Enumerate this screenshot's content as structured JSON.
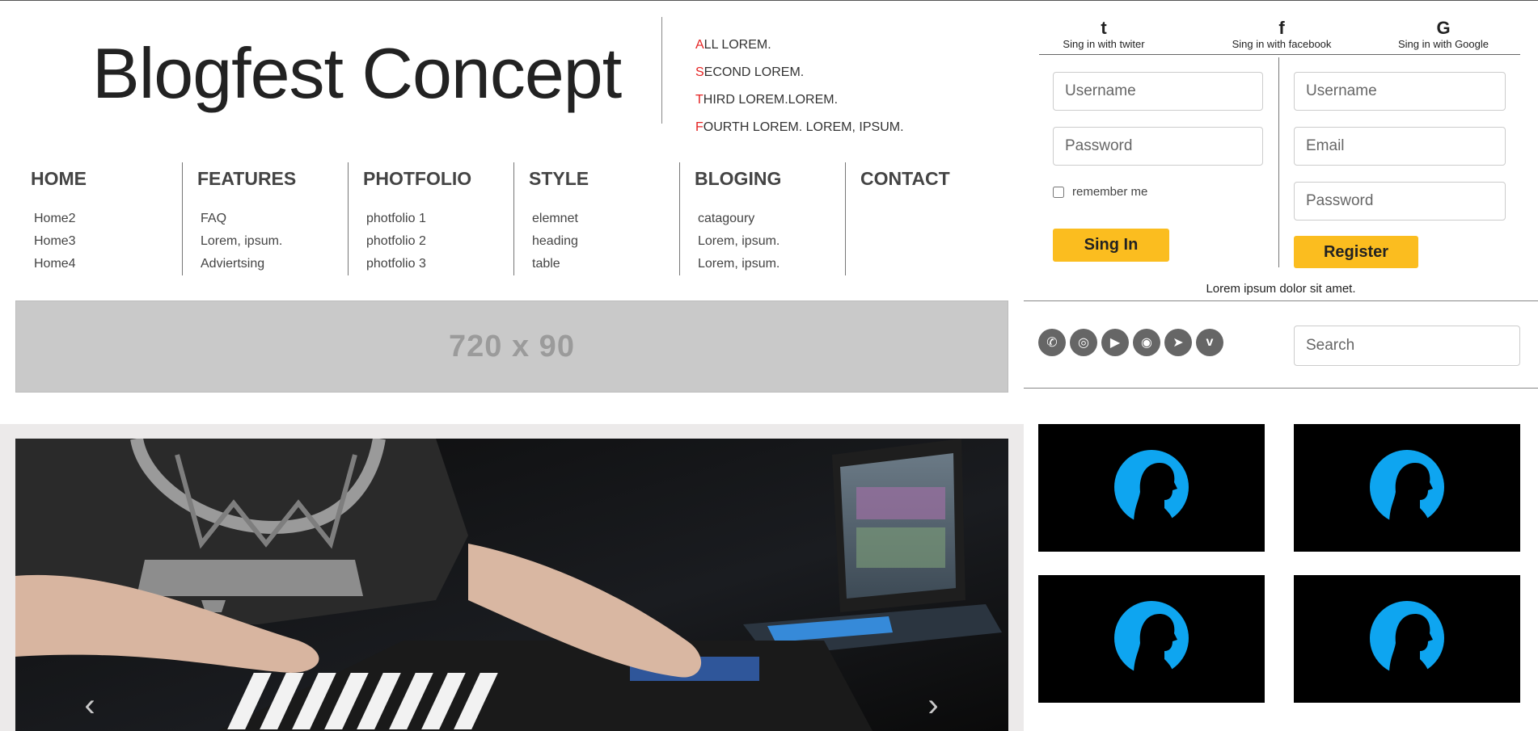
{
  "header": {
    "title": "Blogfest Concept",
    "quick_links": [
      {
        "first": "A",
        "rest": "LL LOREM."
      },
      {
        "first": "S",
        "rest": "ECOND LOREM."
      },
      {
        "first": "T",
        "rest": "HIRD LOREM.LOREM."
      },
      {
        "first": "F",
        "rest": "OURTH LOREM. LOREM, IPSUM."
      }
    ]
  },
  "nav": [
    {
      "title": "HOME",
      "items": [
        "Home2",
        "Home3",
        "Home4"
      ]
    },
    {
      "title": "FEATURES",
      "items": [
        "FAQ",
        "Lorem, ipsum.",
        "Adviertsing"
      ]
    },
    {
      "title": "PHOTFOLIO",
      "items": [
        "photfolio 1",
        "photfolio 2",
        "photfolio 3"
      ]
    },
    {
      "title": "STYLE",
      "items": [
        "elemnet",
        "heading",
        "table"
      ]
    },
    {
      "title": "BLOGING",
      "items": [
        "catagoury",
        "Lorem, ipsum.",
        "Lorem, ipsum."
      ]
    },
    {
      "title": "CONTACT",
      "items": []
    }
  ],
  "ad": {
    "label": "720 x 90"
  },
  "carousel": {
    "prev_icon": "chevron-left-icon",
    "next_icon": "chevron-right-icon",
    "prev": "‹",
    "next": "›"
  },
  "social_signin": [
    {
      "icon": "twitter-icon",
      "glyph": "t",
      "label": "Sing in with twiter"
    },
    {
      "icon": "facebook-icon",
      "glyph": "f",
      "label": "Sing in with facebook"
    },
    {
      "icon": "google-icon",
      "glyph": "G",
      "label": "Sing in with Google"
    }
  ],
  "login": {
    "username_placeholder": "Username",
    "password_placeholder": "Password",
    "remember_label": "remember me",
    "submit_label": "Sing In"
  },
  "register": {
    "username_placeholder": "Username",
    "email_placeholder": "Email",
    "password_placeholder": "Password",
    "submit_label": "Register"
  },
  "tagline": "Lorem ipsum dolor sit amet.",
  "social_icons": [
    {
      "name": "whatsapp-icon",
      "glyph": "✆"
    },
    {
      "name": "instagram-icon",
      "glyph": "◎"
    },
    {
      "name": "youtube-icon",
      "glyph": "▶"
    },
    {
      "name": "chrome-icon",
      "glyph": "◉"
    },
    {
      "name": "telegram-icon",
      "glyph": "➤"
    },
    {
      "name": "vimeo-icon",
      "glyph": "v"
    }
  ],
  "search": {
    "placeholder": "Search"
  },
  "colors": {
    "accent_yellow": "#fbbd1f",
    "quick_link_red": "#e52323",
    "avatar_blue": "#0ea5f0"
  }
}
